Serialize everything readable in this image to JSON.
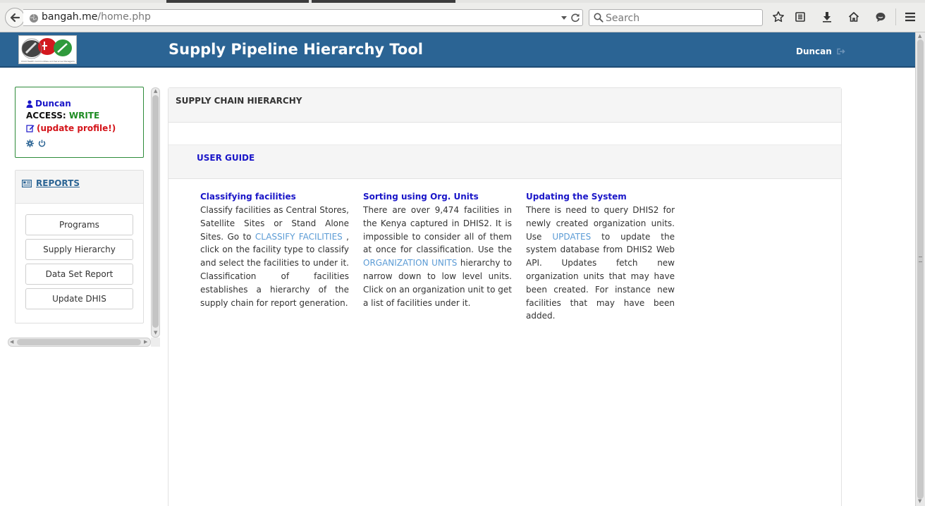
{
  "browser": {
    "url_host": "bangah.me",
    "url_path": "/home.php",
    "search_placeholder": "Search"
  },
  "header": {
    "logo_caption": "Child Health Commodities and Services Management",
    "title": "Supply Pipeline Hierarchy Tool",
    "user": "Duncan"
  },
  "user_box": {
    "name": "Duncan",
    "access_label": "ACCESS:",
    "access_value": "WRITE",
    "update_profile": "(update profile!)"
  },
  "reports": {
    "title": "REPORTS",
    "buttons": [
      "Programs",
      "Supply Hierarchy",
      "Data Set Report",
      "Update DHIS"
    ]
  },
  "main": {
    "title": "SUPPLY CHAIN HIERARCHY",
    "guide_title": "USER GUIDE",
    "columns": [
      {
        "heading": "Classifying facilities",
        "text_before": "Classify facilities as Central Stores, Satellite Sites or Stand Alone Sites. Go to ",
        "link": "CLASSIFY FACILITIES",
        "text_after": " , click on the facility type to classify and select the facilities to under it. Classification of facilities establishes a hierarchy of the supply chain for report generation."
      },
      {
        "heading": "Sorting using Org. Units",
        "text_before": "There are over 9,474 facilities in the Kenya captured in DHIS2. It is impossible to consider all of them at once for classification. Use the ",
        "link": "ORGANIZATION UNITS",
        "text_after": " hierarchy to narrow down to low level units. Click on an organization unit to get a list of facilities under it."
      },
      {
        "heading": "Updating the System",
        "text_before": "There is need to query DHIS2 for newly created organization units. Use ",
        "link": "UPDATES",
        "text_after": " to update the system database from DHIS2 Web API. Updates fetch new organization units that may have been created. For instance new facilities that may have been added."
      }
    ]
  },
  "colors": {
    "header_bg": "#2b6494",
    "heading_blue": "#1a16c8",
    "link_blue": "#5b9bd5",
    "write_green": "#1e8c23",
    "alert_red": "#d4141a"
  }
}
